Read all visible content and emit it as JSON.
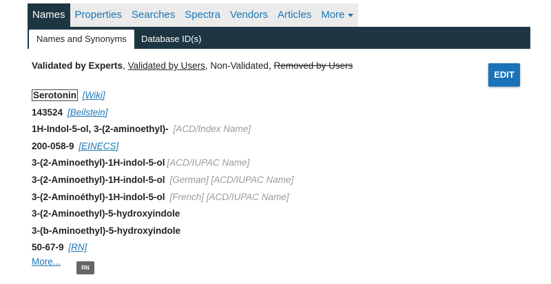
{
  "tabs": [
    "Names",
    "Properties",
    "Searches",
    "Spectra",
    "Vendors",
    "Articles",
    "More"
  ],
  "subtabs": {
    "active": "Names and Synonyms",
    "other": "Database ID(s)"
  },
  "legend": {
    "experts": "Validated by Experts",
    "sep1": ", ",
    "users": "Validated by Users",
    "sep2": ", Non-Validated, ",
    "removed": "Removed by Users"
  },
  "edit_label": "EDIT",
  "synonyms": [
    {
      "name": "Serotonin",
      "link": "[Wiki]"
    },
    {
      "name": "143524",
      "link": "[Beilstein]"
    },
    {
      "name": "1H-Indol-5-ol, 3-(2-aminoethyl)-",
      "note": "[ACD/Index Name]"
    },
    {
      "name": "200-058-9",
      "link": "[EINECS]"
    },
    {
      "name": "3-(2-Aminoethyl)-1H-indol-5-ol",
      "note": "[ACD/IUPAC Name]"
    },
    {
      "name": "3-(2-Aminoethyl)-1H-indol-5-ol",
      "note": "[German] [ACD/IUPAC Name]"
    },
    {
      "name": "3-(2-Aminoéthyl)-1H-indol-5-ol",
      "note": "[French] [ACD/IUPAC Name]"
    },
    {
      "name": "3-(2-Aminoethyl)-5-hydroxyindole"
    },
    {
      "name": "3-(b-Aminoethyl)-5-hydroxyindole"
    },
    {
      "name": "50-67-9",
      "link": "[RN]"
    }
  ],
  "more_label": "More...",
  "badge_label": "RN"
}
